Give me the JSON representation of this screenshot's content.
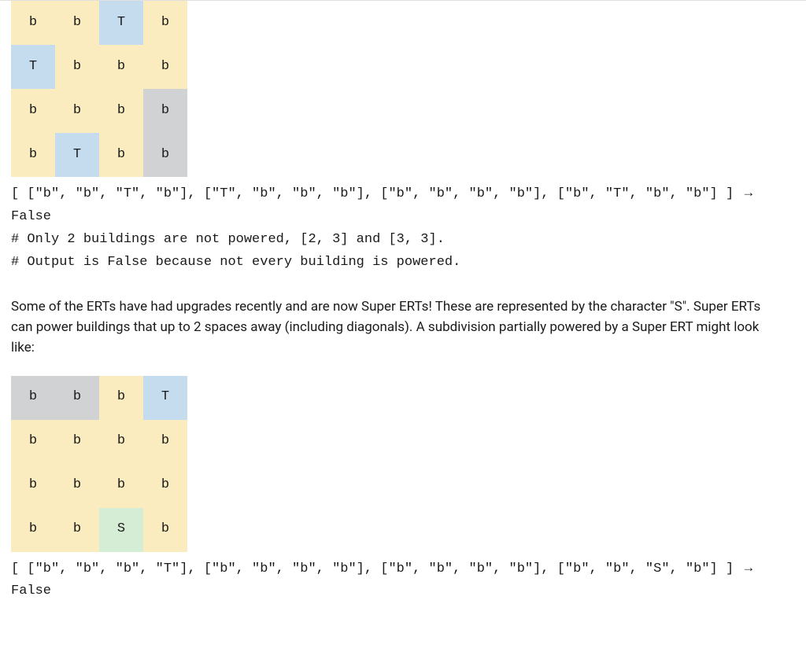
{
  "colors": {
    "yellow": "#faecbf",
    "blue": "#c4dcee",
    "grey": "#d1d2d4",
    "green": "#d5ecd5"
  },
  "grid1": {
    "rows": 4,
    "cols": 4,
    "cells": [
      [
        {
          "v": "b",
          "c": "yellow"
        },
        {
          "v": "b",
          "c": "yellow"
        },
        {
          "v": "T",
          "c": "blue"
        },
        {
          "v": "b",
          "c": "yellow"
        }
      ],
      [
        {
          "v": "T",
          "c": "blue"
        },
        {
          "v": "b",
          "c": "yellow"
        },
        {
          "v": "b",
          "c": "yellow"
        },
        {
          "v": "b",
          "c": "yellow"
        }
      ],
      [
        {
          "v": "b",
          "c": "yellow"
        },
        {
          "v": "b",
          "c": "yellow"
        },
        {
          "v": "b",
          "c": "yellow"
        },
        {
          "v": "b",
          "c": "grey"
        }
      ],
      [
        {
          "v": "b",
          "c": "yellow"
        },
        {
          "v": "T",
          "c": "blue"
        },
        {
          "v": "b",
          "c": "yellow"
        },
        {
          "v": "b",
          "c": "grey"
        }
      ]
    ]
  },
  "code1": {
    "line1": "[ [\"b\", \"b\", \"T\", \"b\"], [\"T\", \"b\", \"b\", \"b\"], [\"b\", \"b\", \"b\", \"b\"], [\"b\", \"T\", \"b\", \"b\"] ] ",
    "arrow": "→",
    "result": " False",
    "comment1": "# Only 2 buildings are not powered, [2, 3] and [3, 3].",
    "comment2": "# Output is False because not every building is powered."
  },
  "prose1": "Some of the ERTs have had upgrades recently and are now Super ERTs! These are represented by the character \"S\". Super ERTs can power buildings that up to 2 spaces away (including diagonals). A subdivision partially powered by a Super ERT might look like:",
  "grid2": {
    "rows": 4,
    "cols": 4,
    "cells": [
      [
        {
          "v": "b",
          "c": "grey"
        },
        {
          "v": "b",
          "c": "grey"
        },
        {
          "v": "b",
          "c": "yellow"
        },
        {
          "v": "T",
          "c": "blue"
        }
      ],
      [
        {
          "v": "b",
          "c": "yellow"
        },
        {
          "v": "b",
          "c": "yellow"
        },
        {
          "v": "b",
          "c": "yellow"
        },
        {
          "v": "b",
          "c": "yellow"
        }
      ],
      [
        {
          "v": "b",
          "c": "yellow"
        },
        {
          "v": "b",
          "c": "yellow"
        },
        {
          "v": "b",
          "c": "yellow"
        },
        {
          "v": "b",
          "c": "yellow"
        }
      ],
      [
        {
          "v": "b",
          "c": "yellow"
        },
        {
          "v": "b",
          "c": "yellow"
        },
        {
          "v": "S",
          "c": "green"
        },
        {
          "v": "b",
          "c": "yellow"
        }
      ]
    ]
  },
  "code2": {
    "line1": "[ [\"b\", \"b\", \"b\", \"T\"], [\"b\", \"b\", \"b\", \"b\"], [\"b\", \"b\", \"b\", \"b\"], [\"b\", \"b\", \"S\", \"b\"] ] ",
    "arrow": "→",
    "result": " False"
  }
}
